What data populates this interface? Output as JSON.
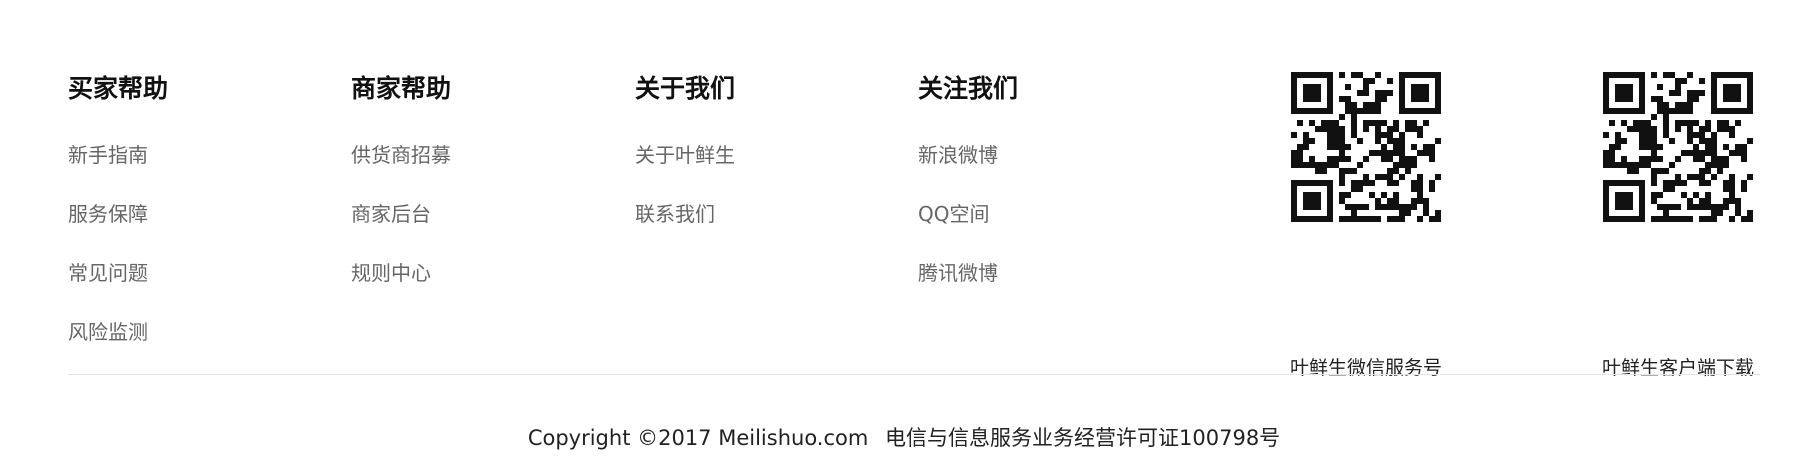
{
  "footer": {
    "columns": [
      {
        "title": "买家帮助",
        "links": [
          "新手指南",
          "服务保障",
          "常见问题",
          "风险监测"
        ]
      },
      {
        "title": "商家帮助",
        "links": [
          "供货商招募",
          "商家后台",
          "规则中心"
        ]
      },
      {
        "title": "关于我们",
        "links": [
          "关于叶鲜生",
          "联系我们"
        ]
      },
      {
        "title": "关注我们",
        "links": [
          "新浪微博",
          "QQ空间",
          "腾讯微博"
        ]
      }
    ],
    "qr_codes": [
      {
        "caption": "叶鲜生微信服务号",
        "icon": "qr-code-icon"
      },
      {
        "caption": "叶鲜生客户端下载",
        "icon": "qr-code-icon"
      }
    ],
    "copyright": "Copyright ©2017 Meilishuo.com",
    "license": "电信与信息服务业务经营许可证100798号"
  },
  "colors": {
    "heading": "#111111",
    "link": "#666666",
    "divider": "#e5e5e5",
    "background": "#ffffff"
  }
}
